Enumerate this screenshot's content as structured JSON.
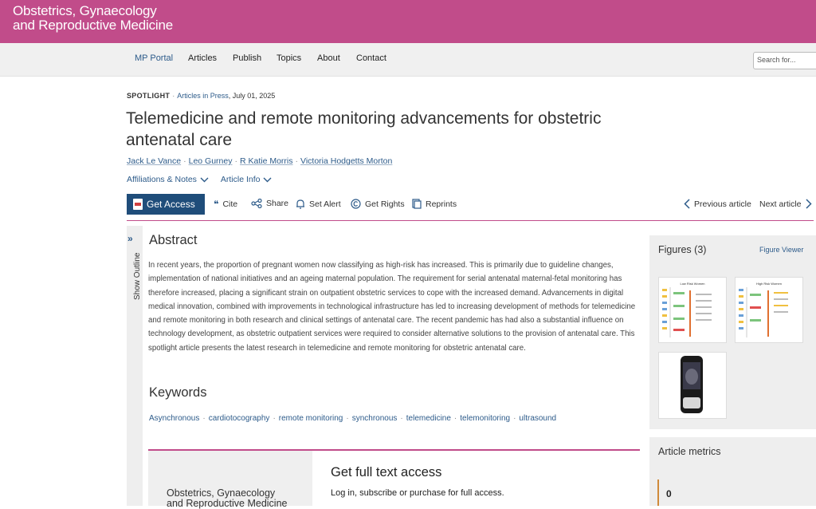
{
  "journal": {
    "title_line1": "Obstetrics, Gynaecology",
    "title_line2": "and Reproductive Medicine"
  },
  "nav": {
    "items": [
      "MP Portal",
      "Articles",
      "Publish",
      "Topics",
      "About",
      "Contact"
    ],
    "search_placeholder": "Search for..."
  },
  "article": {
    "type": "SPOTLIGHT",
    "section": "Articles in Press",
    "date": ", July 01, 2025",
    "title": "Telemedicine and remote monitoring advancements for obstetric antenatal care",
    "authors": [
      "Jack Le Vance",
      "Leo Gurney",
      "R Katie Morris",
      "Victoria Hodgetts Morton"
    ],
    "affiliations_label": "Affiliations & Notes",
    "article_info_label": "Article Info"
  },
  "toolbar": {
    "get_access": "Get Access",
    "cite": "Cite",
    "share": "Share",
    "set_alert": "Set Alert",
    "get_rights": "Get Rights",
    "reprints": "Reprints",
    "previous": "Previous article",
    "next": "Next article"
  },
  "outline": {
    "label": "Show Outline"
  },
  "abstract": {
    "heading": "Abstract",
    "text": "In recent years, the proportion of pregnant women now classifying as high-risk has increased. This is primarily due to guideline changes, implementation of national initiatives and an ageing maternal population. The requirement for serial antenatal maternal-fetal monitoring has therefore increased, placing a significant strain on outpatient obstetric services to cope with the increased demand. Advancements in digital medical innovation, combined with improvements in technological infrastructure has led to increasing development of methods for telemedicine and remote monitoring in both research and clinical settings of antenatal care. The recent pandemic has had also a substantial influence on technology development, as obstetric outpatient services were required to consider alternative solutions to the provision of antenatal care. This spotlight article presents the latest research in telemedicine and remote monitoring for obstetric antenatal care."
  },
  "keywords": {
    "heading": "Keywords",
    "items": [
      "Asynchronous",
      "cardiotocography",
      "remote monitoring",
      "synchronous",
      "telemedicine",
      "telemonitoring",
      "ultrasound"
    ]
  },
  "access": {
    "title": "Get full text access",
    "subtitle": "Log in, subscribe or purchase for full access.",
    "logo_line1": "Obstetrics, Gynaecology",
    "logo_line2": "and Reproductive Medicine"
  },
  "figures": {
    "heading": "Figures (3)",
    "viewer_link": "Figure Viewer",
    "thumb1_title": "Low Risk Women",
    "thumb2_title": "High Risk Women"
  },
  "metrics": {
    "heading": "Article metrics",
    "value": "0"
  },
  "colors": {
    "brand": "#c14c8a",
    "link": "#2d5b8a",
    "button": "#1f4d7a"
  }
}
